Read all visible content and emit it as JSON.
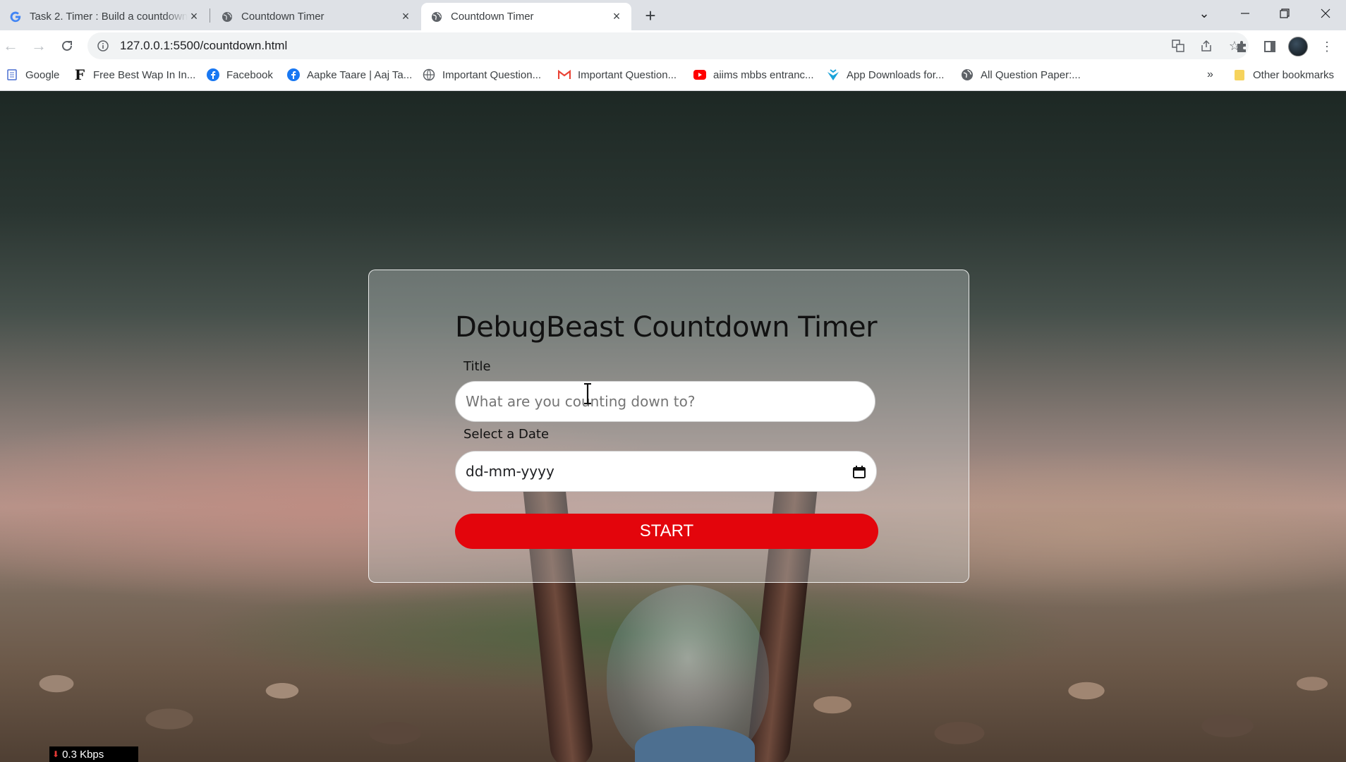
{
  "browser": {
    "tabs": [
      {
        "title": "Task 2. Timer : Build a countdown",
        "icon": "google-icon",
        "active": false
      },
      {
        "title": "Countdown Timer",
        "icon": "globe-icon",
        "active": false
      },
      {
        "title": "Countdown Timer",
        "icon": "globe-icon",
        "active": true
      }
    ],
    "new_tab": "+",
    "url": "127.0.0.1:5500/countdown.html",
    "bookmarks": [
      {
        "label": "Google",
        "icon": "google-apps-icon"
      },
      {
        "label": "Free Best Wap In In...",
        "icon": "f-logo-icon"
      },
      {
        "label": "Facebook",
        "icon": "facebook-icon"
      },
      {
        "label": "Aapke Taare | Aaj Ta...",
        "icon": "facebook-icon"
      },
      {
        "label": "Important Question...",
        "icon": "globe-icon"
      },
      {
        "label": "Important Question...",
        "icon": "gmail-icon"
      },
      {
        "label": "aiims mbbs entranc...",
        "icon": "youtube-icon"
      },
      {
        "label": "App Downloads for...",
        "icon": "app-download-icon"
      },
      {
        "label": "All Question Paper:...",
        "icon": "globe-icon"
      }
    ],
    "more_bookmarks": "»",
    "other_bookmarks": "Other bookmarks"
  },
  "app": {
    "title": "DebugBeast Countdown Timer",
    "title_label": "Title",
    "title_placeholder": "What are you counting down to?",
    "date_label": "Select a Date",
    "date_placeholder": "dd-mm-yyyy",
    "start_label": "START"
  },
  "status": {
    "net_speed": "0.3 Kbps"
  },
  "colors": {
    "start_button": "#e3050c",
    "tab_strip": "#dee1e6"
  }
}
